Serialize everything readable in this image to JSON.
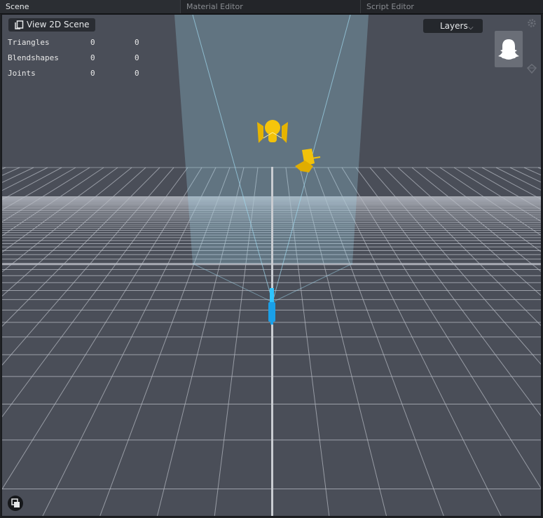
{
  "tabs": [
    {
      "label": "Scene",
      "active": true
    },
    {
      "label": "Material Editor",
      "active": false
    },
    {
      "label": "Script Editor",
      "active": false
    }
  ],
  "viewport": {
    "view_2d_label": "View 2D Scene",
    "layers_label": "Layers",
    "stats": [
      {
        "label": "Triangles",
        "value1": "0",
        "value2": "0"
      },
      {
        "label": "Blendshapes",
        "value1": "0",
        "value2": "0"
      },
      {
        "label": "Joints",
        "value1": "0",
        "value2": "0"
      }
    ]
  },
  "icons": {
    "view2d": "copy-pages-icon",
    "layers_chevron": "chevron-down-icon",
    "ghost": "snapchat-ghost-icon",
    "settings": "gear-icon",
    "gem": "gem-icon",
    "corner": "overlap-squares-icon"
  },
  "colors": {
    "viewport_bg": "#4a4e58",
    "grid_line": "#b8bcc4",
    "frustum": "#9fd8ee",
    "light_gizmo": "#f2c20a",
    "camera_gizmo": "#1aa0e8"
  }
}
